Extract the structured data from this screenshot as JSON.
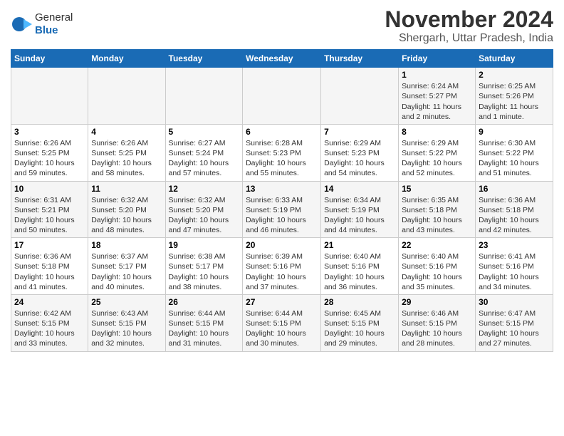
{
  "header": {
    "logo_general": "General",
    "logo_blue": "Blue",
    "title": "November 2024",
    "subtitle": "Shergarh, Uttar Pradesh, India"
  },
  "days_of_week": [
    "Sunday",
    "Monday",
    "Tuesday",
    "Wednesday",
    "Thursday",
    "Friday",
    "Saturday"
  ],
  "weeks": [
    [
      {
        "day": "",
        "detail": ""
      },
      {
        "day": "",
        "detail": ""
      },
      {
        "day": "",
        "detail": ""
      },
      {
        "day": "",
        "detail": ""
      },
      {
        "day": "",
        "detail": ""
      },
      {
        "day": "1",
        "detail": "Sunrise: 6:24 AM\nSunset: 5:27 PM\nDaylight: 11 hours and 2 minutes."
      },
      {
        "day": "2",
        "detail": "Sunrise: 6:25 AM\nSunset: 5:26 PM\nDaylight: 11 hours and 1 minute."
      }
    ],
    [
      {
        "day": "3",
        "detail": "Sunrise: 6:26 AM\nSunset: 5:25 PM\nDaylight: 10 hours and 59 minutes."
      },
      {
        "day": "4",
        "detail": "Sunrise: 6:26 AM\nSunset: 5:25 PM\nDaylight: 10 hours and 58 minutes."
      },
      {
        "day": "5",
        "detail": "Sunrise: 6:27 AM\nSunset: 5:24 PM\nDaylight: 10 hours and 57 minutes."
      },
      {
        "day": "6",
        "detail": "Sunrise: 6:28 AM\nSunset: 5:23 PM\nDaylight: 10 hours and 55 minutes."
      },
      {
        "day": "7",
        "detail": "Sunrise: 6:29 AM\nSunset: 5:23 PM\nDaylight: 10 hours and 54 minutes."
      },
      {
        "day": "8",
        "detail": "Sunrise: 6:29 AM\nSunset: 5:22 PM\nDaylight: 10 hours and 52 minutes."
      },
      {
        "day": "9",
        "detail": "Sunrise: 6:30 AM\nSunset: 5:22 PM\nDaylight: 10 hours and 51 minutes."
      }
    ],
    [
      {
        "day": "10",
        "detail": "Sunrise: 6:31 AM\nSunset: 5:21 PM\nDaylight: 10 hours and 50 minutes."
      },
      {
        "day": "11",
        "detail": "Sunrise: 6:32 AM\nSunset: 5:20 PM\nDaylight: 10 hours and 48 minutes."
      },
      {
        "day": "12",
        "detail": "Sunrise: 6:32 AM\nSunset: 5:20 PM\nDaylight: 10 hours and 47 minutes."
      },
      {
        "day": "13",
        "detail": "Sunrise: 6:33 AM\nSunset: 5:19 PM\nDaylight: 10 hours and 46 minutes."
      },
      {
        "day": "14",
        "detail": "Sunrise: 6:34 AM\nSunset: 5:19 PM\nDaylight: 10 hours and 44 minutes."
      },
      {
        "day": "15",
        "detail": "Sunrise: 6:35 AM\nSunset: 5:18 PM\nDaylight: 10 hours and 43 minutes."
      },
      {
        "day": "16",
        "detail": "Sunrise: 6:36 AM\nSunset: 5:18 PM\nDaylight: 10 hours and 42 minutes."
      }
    ],
    [
      {
        "day": "17",
        "detail": "Sunrise: 6:36 AM\nSunset: 5:18 PM\nDaylight: 10 hours and 41 minutes."
      },
      {
        "day": "18",
        "detail": "Sunrise: 6:37 AM\nSunset: 5:17 PM\nDaylight: 10 hours and 40 minutes."
      },
      {
        "day": "19",
        "detail": "Sunrise: 6:38 AM\nSunset: 5:17 PM\nDaylight: 10 hours and 38 minutes."
      },
      {
        "day": "20",
        "detail": "Sunrise: 6:39 AM\nSunset: 5:16 PM\nDaylight: 10 hours and 37 minutes."
      },
      {
        "day": "21",
        "detail": "Sunrise: 6:40 AM\nSunset: 5:16 PM\nDaylight: 10 hours and 36 minutes."
      },
      {
        "day": "22",
        "detail": "Sunrise: 6:40 AM\nSunset: 5:16 PM\nDaylight: 10 hours and 35 minutes."
      },
      {
        "day": "23",
        "detail": "Sunrise: 6:41 AM\nSunset: 5:16 PM\nDaylight: 10 hours and 34 minutes."
      }
    ],
    [
      {
        "day": "24",
        "detail": "Sunrise: 6:42 AM\nSunset: 5:15 PM\nDaylight: 10 hours and 33 minutes."
      },
      {
        "day": "25",
        "detail": "Sunrise: 6:43 AM\nSunset: 5:15 PM\nDaylight: 10 hours and 32 minutes."
      },
      {
        "day": "26",
        "detail": "Sunrise: 6:44 AM\nSunset: 5:15 PM\nDaylight: 10 hours and 31 minutes."
      },
      {
        "day": "27",
        "detail": "Sunrise: 6:44 AM\nSunset: 5:15 PM\nDaylight: 10 hours and 30 minutes."
      },
      {
        "day": "28",
        "detail": "Sunrise: 6:45 AM\nSunset: 5:15 PM\nDaylight: 10 hours and 29 minutes."
      },
      {
        "day": "29",
        "detail": "Sunrise: 6:46 AM\nSunset: 5:15 PM\nDaylight: 10 hours and 28 minutes."
      },
      {
        "day": "30",
        "detail": "Sunrise: 6:47 AM\nSunset: 5:15 PM\nDaylight: 10 hours and 27 minutes."
      }
    ]
  ]
}
